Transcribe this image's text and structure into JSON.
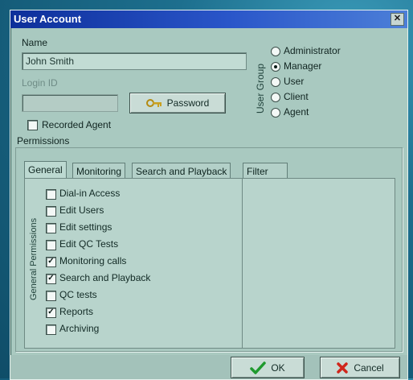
{
  "window": {
    "title": "User Account",
    "close_glyph": "✕"
  },
  "name": {
    "label": "Name",
    "value": "John Smith"
  },
  "login": {
    "label": "Login ID",
    "value": ""
  },
  "password_button": {
    "label": "Password",
    "icon": "key-icon"
  },
  "recorded_agent": {
    "label": "Recorded Agent",
    "checked": false
  },
  "user_group": {
    "label": "User Group",
    "options": [
      {
        "label": "Administrator",
        "selected": false
      },
      {
        "label": "Manager",
        "selected": true
      },
      {
        "label": "User",
        "selected": false
      },
      {
        "label": "Client",
        "selected": false
      },
      {
        "label": "Agent",
        "selected": false
      }
    ]
  },
  "permissions": {
    "label": "Permissions",
    "tabs": [
      {
        "label": "General",
        "active": true
      },
      {
        "label": "Monitoring",
        "active": false
      },
      {
        "label": "Search and Playback",
        "active": false
      },
      {
        "label": "Filter",
        "active": false
      }
    ],
    "general_label": "General Permissions",
    "items": [
      {
        "label": "Dial-in Access",
        "checked": false
      },
      {
        "label": "Edit Users",
        "checked": false
      },
      {
        "label": "Edit settings",
        "checked": false
      },
      {
        "label": "Edit QC Tests",
        "checked": false
      },
      {
        "label": "Monitoring calls",
        "checked": true
      },
      {
        "label": "Search and Playback",
        "checked": true
      },
      {
        "label": "QC tests",
        "checked": false
      },
      {
        "label": "Reports",
        "checked": true
      },
      {
        "label": "Archiving",
        "checked": false
      }
    ]
  },
  "buttons": {
    "ok": "OK",
    "cancel": "Cancel"
  },
  "colors": {
    "title_bar": "#0d2f9a",
    "ok_check": "#1f9a2e",
    "cancel_x": "#d0261b"
  }
}
